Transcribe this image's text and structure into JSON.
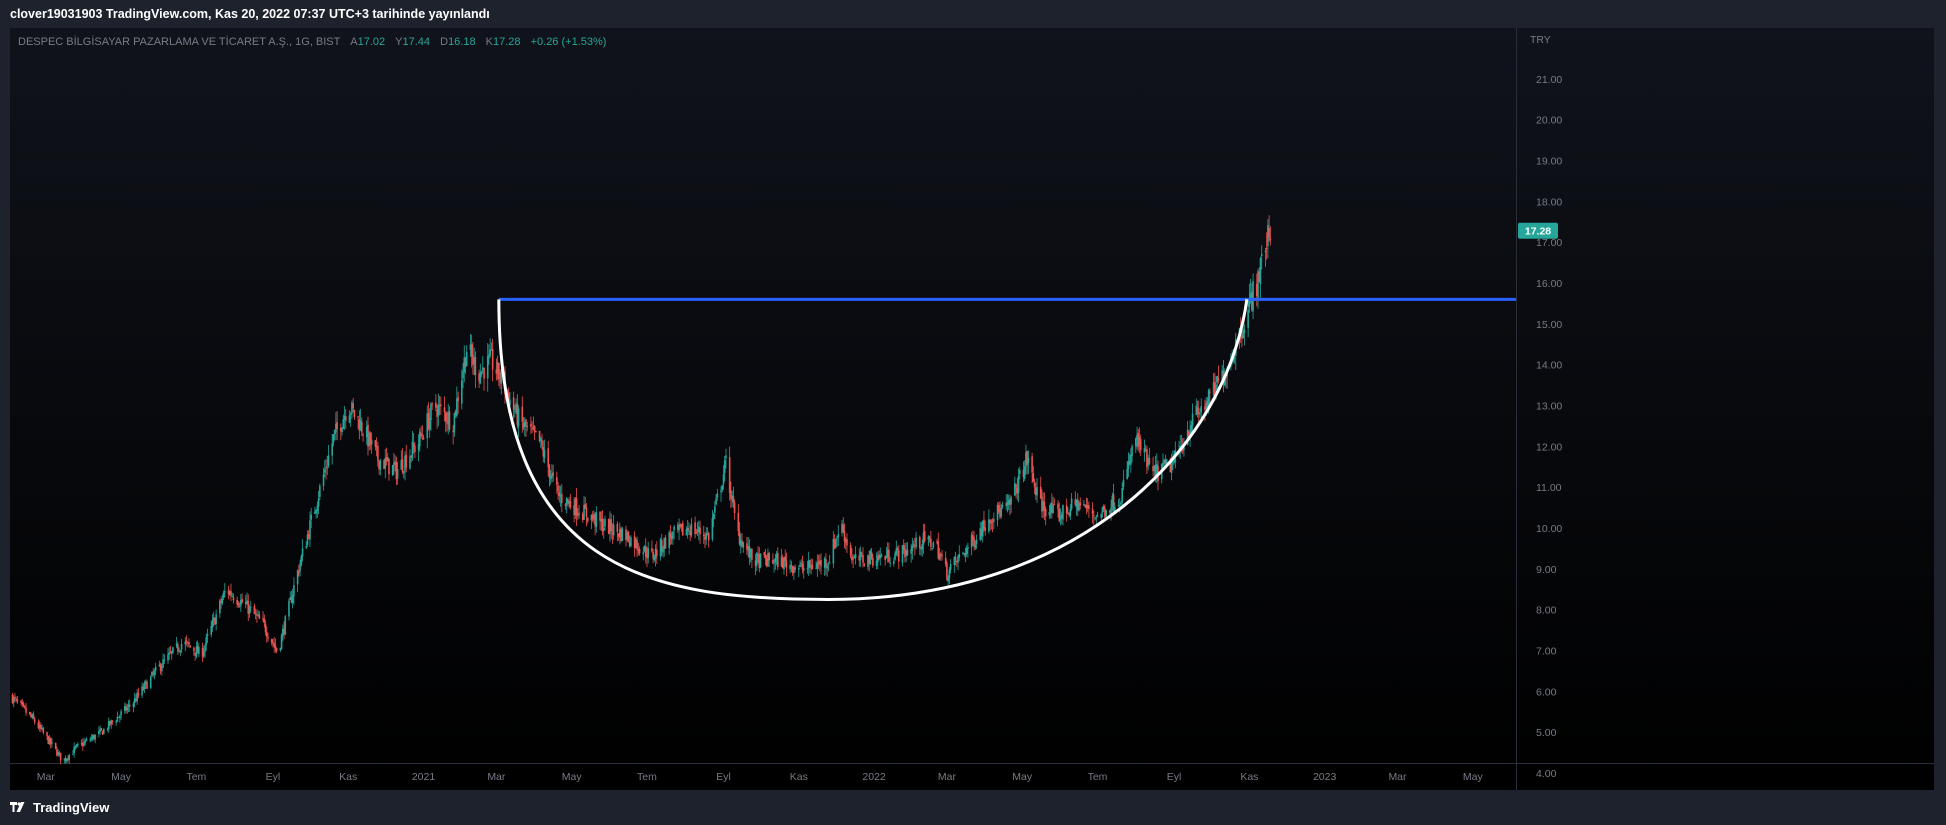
{
  "header": {
    "publish_line": "clover19031903 TradingView.com, Kas 20, 2022 07:37 UTC+3 tarihinde yayınlandı"
  },
  "legend": {
    "symbol": "DESPEC BİLGİSAYAR PAZARLAMA VE TİCARET A.Ş., 1G, BIST",
    "open_label": "A",
    "open": "17.02",
    "high_label": "Y",
    "high": "17.44",
    "low_label": "D",
    "low": "16.18",
    "close_label": "K",
    "close": "17.28",
    "change": "+0.26 (+1.53%)"
  },
  "footer": {
    "brand": "TradingView"
  },
  "colors": {
    "up": "#26a69a",
    "down": "#ef5350",
    "resistance": "#2962ff",
    "cup": "#ffffff",
    "price_badge": "#26a69a",
    "grid_text": "#787b86"
  },
  "chart_data": {
    "type": "candlestick",
    "currency": "TRY",
    "last_price": "17.28",
    "ylim": [
      4,
      22
    ],
    "y_ticks": [
      "4.00",
      "5.00",
      "6.00",
      "7.00",
      "8.00",
      "9.00",
      "10.00",
      "11.00",
      "12.00",
      "13.00",
      "14.00",
      "15.00",
      "16.00",
      "17.00",
      "18.00",
      "19.00",
      "20.00",
      "21.00"
    ],
    "x_ticks": [
      {
        "label": "Mar",
        "date": "2020-03-01"
      },
      {
        "label": "May",
        "date": "2020-05-01"
      },
      {
        "label": "Tem",
        "date": "2020-07-01"
      },
      {
        "label": "Eyl",
        "date": "2020-09-01"
      },
      {
        "label": "Kas",
        "date": "2020-11-01"
      },
      {
        "label": "2021",
        "date": "2021-01-01"
      },
      {
        "label": "Mar",
        "date": "2021-03-01"
      },
      {
        "label": "May",
        "date": "2021-05-01"
      },
      {
        "label": "Tem",
        "date": "2021-07-01"
      },
      {
        "label": "Eyl",
        "date": "2021-09-01"
      },
      {
        "label": "Kas",
        "date": "2021-11-01"
      },
      {
        "label": "2022",
        "date": "2022-01-01"
      },
      {
        "label": "Mar",
        "date": "2022-03-01"
      },
      {
        "label": "May",
        "date": "2022-05-01"
      },
      {
        "label": "Tem",
        "date": "2022-07-01"
      },
      {
        "label": "Eyl",
        "date": "2022-09-01"
      },
      {
        "label": "Kas",
        "date": "2022-11-01"
      },
      {
        "label": "2023",
        "date": "2023-01-01"
      },
      {
        "label": "Mar",
        "date": "2023-03-01"
      },
      {
        "label": "May",
        "date": "2023-05-01"
      }
    ],
    "price_path": [
      [
        "2020-02-01",
        5.9
      ],
      [
        "2020-02-20",
        5.3
      ],
      [
        "2020-03-15",
        4.3
      ],
      [
        "2020-03-25",
        4.6
      ],
      [
        "2020-04-15",
        5.0
      ],
      [
        "2020-05-10",
        5.7
      ],
      [
        "2020-06-01",
        6.6
      ],
      [
        "2020-06-20",
        7.2
      ],
      [
        "2020-07-05",
        6.9
      ],
      [
        "2020-07-25",
        8.5
      ],
      [
        "2020-08-10",
        8.1
      ],
      [
        "2020-08-25",
        7.6
      ],
      [
        "2020-09-05",
        6.95
      ],
      [
        "2020-09-20",
        8.8
      ],
      [
        "2020-10-05",
        10.5
      ],
      [
        "2020-10-20",
        12.2
      ],
      [
        "2020-11-01",
        13.0
      ],
      [
        "2020-11-10",
        12.6
      ],
      [
        "2020-11-25",
        11.7
      ],
      [
        "2020-12-10",
        11.4
      ],
      [
        "2020-12-28",
        12.1
      ],
      [
        "2021-01-10",
        13.0
      ],
      [
        "2021-01-25",
        12.6
      ],
      [
        "2021-02-05",
        14.4
      ],
      [
        "2021-02-15",
        13.8
      ],
      [
        "2021-02-25",
        14.1
      ],
      [
        "2021-03-05",
        13.6
      ],
      [
        "2021-03-20",
        12.6
      ],
      [
        "2021-04-05",
        12.1
      ],
      [
        "2021-04-20",
        10.8
      ],
      [
        "2021-05-05",
        10.5
      ],
      [
        "2021-05-25",
        10.1
      ],
      [
        "2021-06-15",
        9.8
      ],
      [
        "2021-07-05",
        9.3
      ],
      [
        "2021-07-20",
        9.8
      ],
      [
        "2021-08-05",
        10.0
      ],
      [
        "2021-08-20",
        9.8
      ],
      [
        "2021-09-03",
        11.6
      ],
      [
        "2021-09-12",
        9.9
      ],
      [
        "2021-09-25",
        9.2
      ],
      [
        "2021-10-15",
        9.2
      ],
      [
        "2021-11-05",
        9.0
      ],
      [
        "2021-11-25",
        9.2
      ],
      [
        "2021-12-05",
        10.1
      ],
      [
        "2021-12-15",
        9.2
      ],
      [
        "2022-01-10",
        9.3
      ],
      [
        "2022-01-25",
        9.4
      ],
      [
        "2022-02-10",
        9.7
      ],
      [
        "2022-02-20",
        9.6
      ],
      [
        "2022-03-01",
        8.9
      ],
      [
        "2022-03-20",
        9.6
      ],
      [
        "2022-04-05",
        10.3
      ],
      [
        "2022-04-20",
        10.5
      ],
      [
        "2022-05-05",
        11.7
      ],
      [
        "2022-05-15",
        10.6
      ],
      [
        "2022-05-30",
        10.3
      ],
      [
        "2022-06-15",
        10.6
      ],
      [
        "2022-07-01",
        10.3
      ],
      [
        "2022-07-20",
        10.8
      ],
      [
        "2022-08-01",
        12.2
      ],
      [
        "2022-08-15",
        11.3
      ],
      [
        "2022-09-01",
        11.6
      ],
      [
        "2022-09-15",
        12.6
      ],
      [
        "2022-10-01",
        13.2
      ],
      [
        "2022-10-15",
        14.0
      ],
      [
        "2022-10-28",
        15.1
      ],
      [
        "2022-11-07",
        16.0
      ],
      [
        "2022-11-14",
        16.9
      ],
      [
        "2022-11-18",
        17.28
      ]
    ],
    "annotations": [
      {
        "type": "horizontal_resistance_line",
        "price": 15.6,
        "start": "2021-03-03"
      },
      {
        "type": "cup_curve",
        "start": [
          "2021-03-03",
          15.6
        ],
        "bottom": [
          "2021-11-25",
          8.25
        ],
        "end": [
          "2022-10-30",
          15.6
        ]
      }
    ]
  }
}
